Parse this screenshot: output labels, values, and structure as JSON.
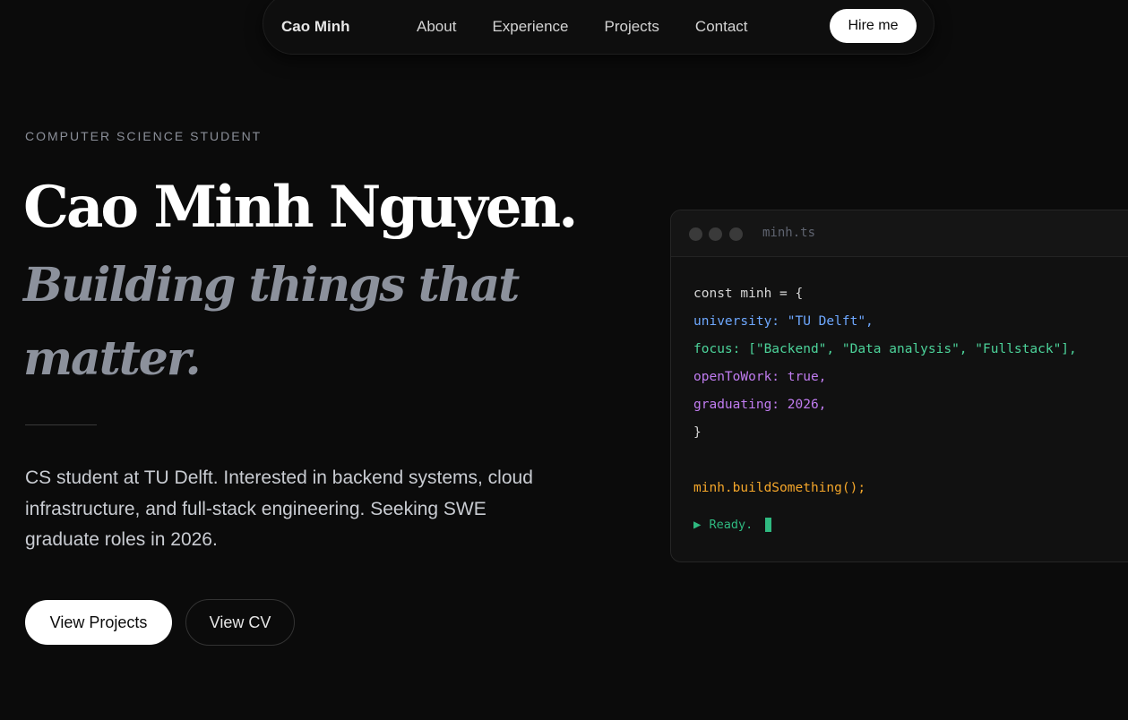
{
  "nav": {
    "brand": "Cao Minh",
    "links": [
      "About",
      "Experience",
      "Projects",
      "Contact"
    ],
    "cta": "Hire me"
  },
  "hero": {
    "eyebrow": "COMPUTER SCIENCE STUDENT",
    "title": "Cao Minh Nguyen.",
    "subtitle": "Building things that matter.",
    "intro": "CS student at TU Delft. Interested in backend systems, cloud infrastructure, and full-stack engineering. Seeking SWE graduate roles in 2026.",
    "primary_button": "View Projects",
    "secondary_button": "View CV"
  },
  "code_window": {
    "filename": "minh.ts",
    "lines": [
      "const minh = {",
      "university: \"TU Delft\",",
      "focus: [\"Backend\", \"Data analysis\", \"Fullstack\"],",
      "openToWork: true,",
      "graduating: 2026,",
      "}",
      "",
      "minh.buildSomething();"
    ],
    "status": "Ready.",
    "status_icon": "play-icon"
  },
  "colors": {
    "background": "#0b0b0b",
    "accent_green": "#2fb980",
    "code_blue": "#6ea8ff",
    "code_purple": "#c07cf0",
    "code_orange": "#f4a62a"
  }
}
